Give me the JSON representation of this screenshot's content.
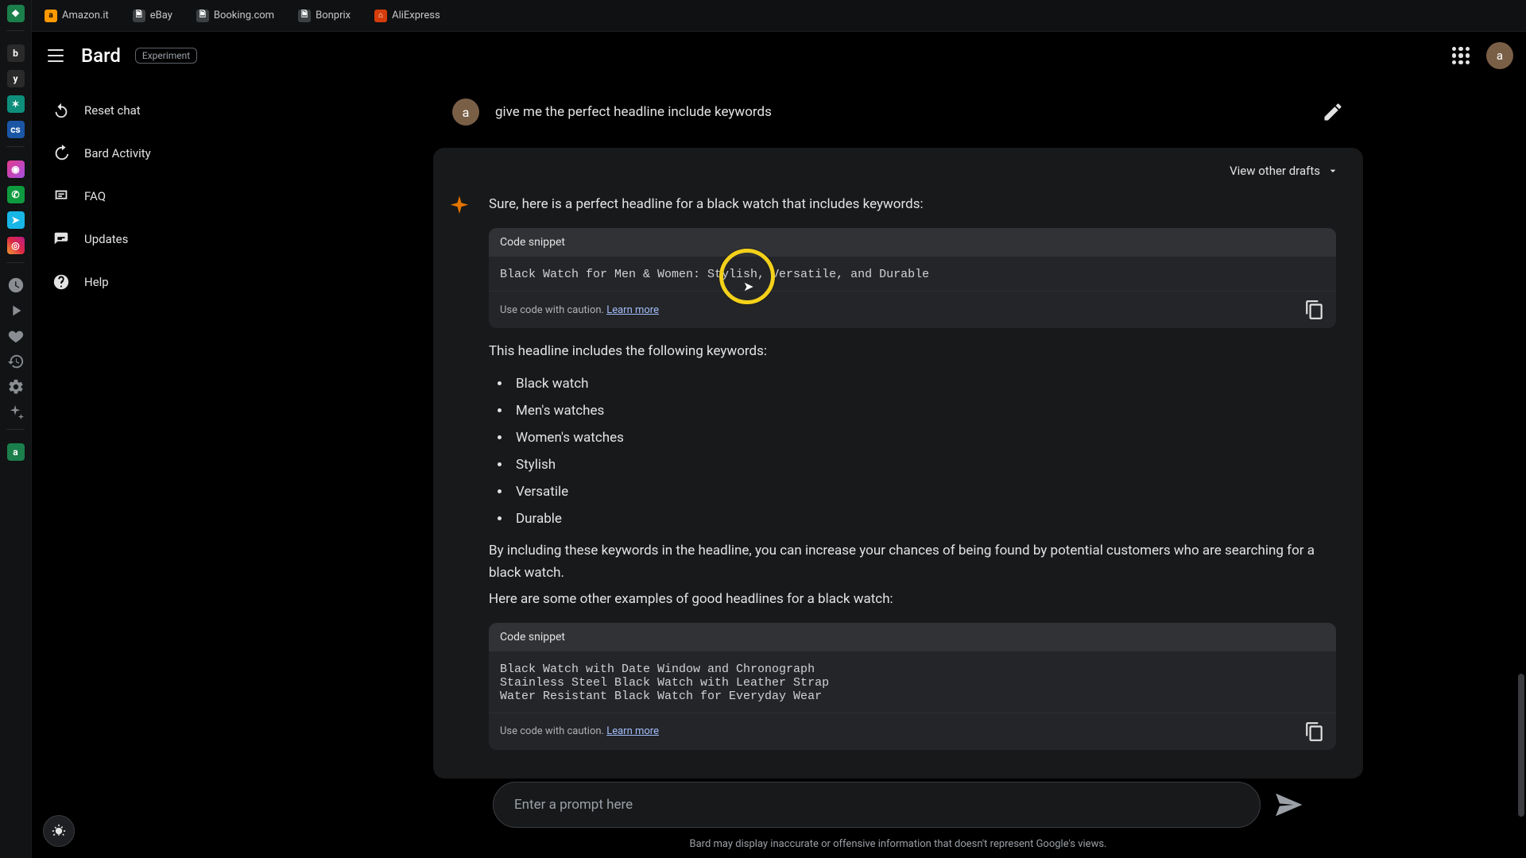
{
  "bookmarks": [
    {
      "label": "Amazon.it",
      "iconClass": "amazon",
      "letter": "a"
    },
    {
      "label": "eBay",
      "iconClass": "doc",
      "letter": ""
    },
    {
      "label": "Booking.com",
      "iconClass": "doc",
      "letter": ""
    },
    {
      "label": "Bonprix",
      "iconClass": "doc",
      "letter": ""
    },
    {
      "label": "AliExpress",
      "iconClass": "ali",
      "letter": ""
    }
  ],
  "header": {
    "brand": "Bard",
    "badge": "Experiment",
    "avatar_letter": "a"
  },
  "sidebar": {
    "items": [
      {
        "label": "Reset chat",
        "icon": "reset-icon"
      },
      {
        "label": "Bard Activity",
        "icon": "activity-icon"
      },
      {
        "label": "FAQ",
        "icon": "faq-icon"
      },
      {
        "label": "Updates",
        "icon": "updates-icon"
      },
      {
        "label": "Help",
        "icon": "help-icon"
      }
    ]
  },
  "prompt": {
    "avatar_letter": "a",
    "text": "give me the perfect headline include keywords"
  },
  "response": {
    "view_drafts": "View other drafts",
    "intro": "Sure, here is a perfect headline for a black watch that includes keywords:",
    "code1": {
      "title": "Code snippet",
      "content": "Black Watch for Men & Women: Stylish, Versatile, and Durable",
      "caution": "Use code with caution.",
      "learn": "Learn more"
    },
    "kw_intro": "This headline includes the following keywords:",
    "keywords": [
      "Black watch",
      "Men's watches",
      "Women's watches",
      "Stylish",
      "Versatile",
      "Durable"
    ],
    "benefit": "By including these keywords in the headline, you can increase your chances of being found by potential customers who are searching for a black watch.",
    "other_intro": "Here are some other examples of good headlines for a black watch:",
    "code2": {
      "title": "Code snippet",
      "content": "Black Watch with Date Window and Chronograph\nStainless Steel Black Watch with Leather Strap\nWater Resistant Black Watch for Everyday Wear",
      "caution": "Use code with caution.",
      "learn": "Learn more"
    }
  },
  "input": {
    "placeholder": "Enter a prompt here"
  },
  "footer": {
    "disclaimer": "Bard may display inaccurate or offensive information that doesn't represent Google's views."
  }
}
